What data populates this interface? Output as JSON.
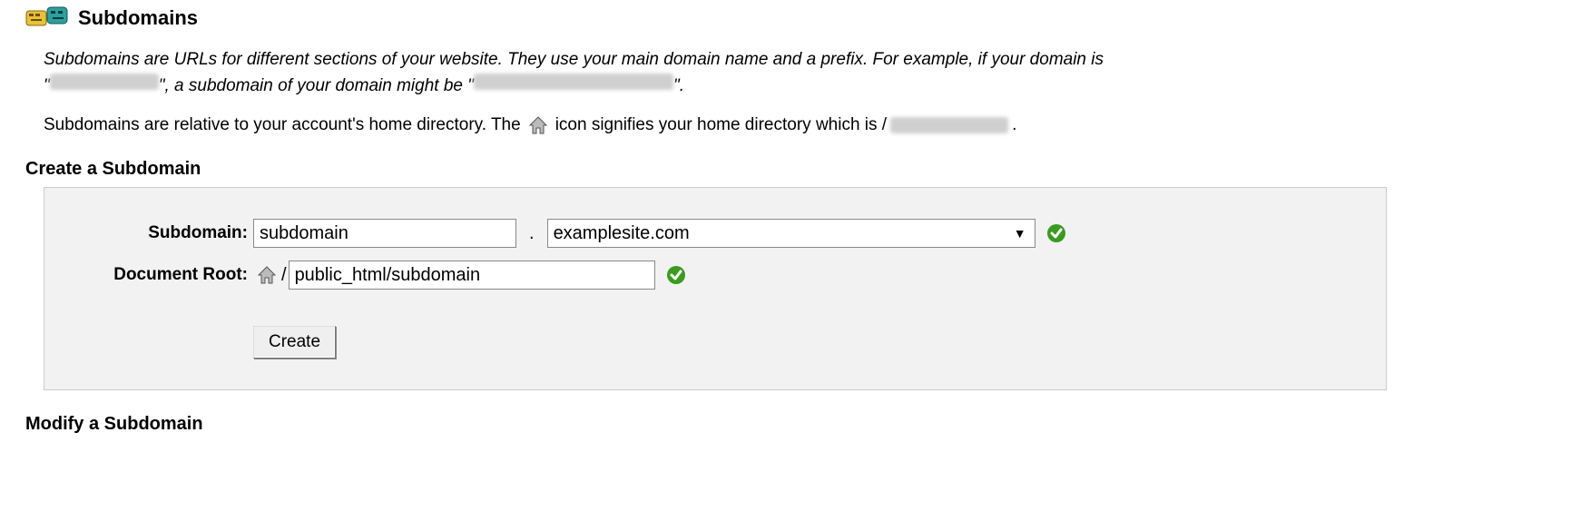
{
  "header": {
    "title": "Subdomains"
  },
  "intro": {
    "line1_a": "Subdomains are URLs for different sections of your website. They use your main domain name and a prefix. For example, if your domain is",
    "quote_open_1": "\"",
    "blur1": "………………",
    "line1_b": "\", a subdomain of your domain might be \"",
    "blur2": "……………………………",
    "line1_c": "\"."
  },
  "info": {
    "pre": "Subdomains are relative to your account's home directory. The",
    "post": "icon signifies your home directory which is /",
    "blur_path": "…………………",
    "end": "."
  },
  "sections": {
    "create": "Create a Subdomain",
    "modify": "Modify a Subdomain"
  },
  "form": {
    "subdomain_label": "Subdomain:",
    "subdomain_value": "subdomain",
    "dot": ".",
    "domain_value": "examplesite.com",
    "domain_options": [
      "examplesite.com"
    ],
    "docroot_label": "Document Root:",
    "slash": "/",
    "docroot_value": "public_html/subdomain",
    "create_button": "Create"
  },
  "icons": {
    "valid": "check",
    "home": "home"
  },
  "colors": {
    "valid_green": "#3a9b1f",
    "icon_badge_yellow": "#e8c13a",
    "icon_badge_teal": "#2f9e9e"
  }
}
